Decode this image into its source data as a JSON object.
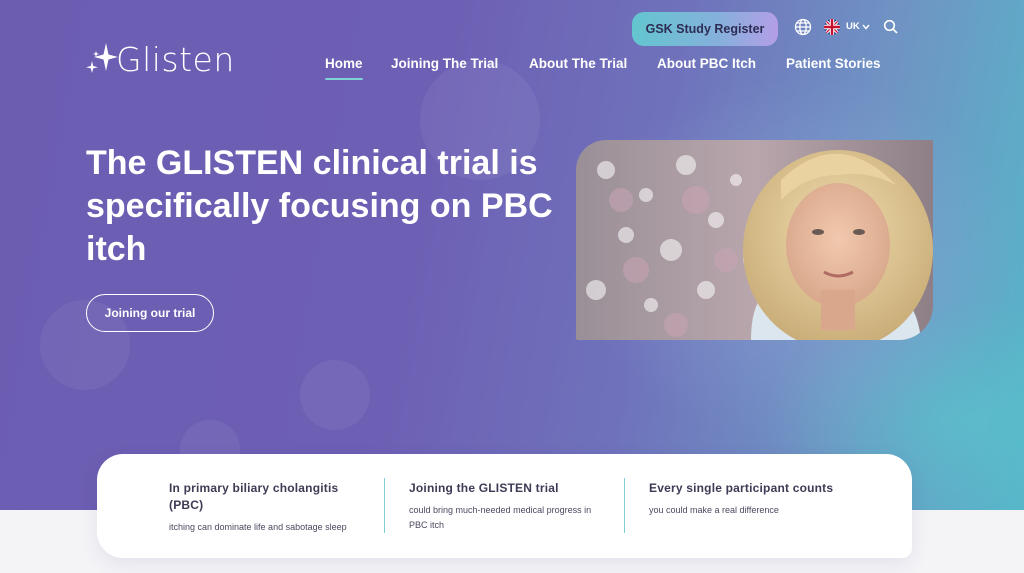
{
  "header": {
    "brand": "Glisten",
    "register_label": "GSK Study Register",
    "language": "UK"
  },
  "nav": {
    "items": [
      {
        "label": "Home",
        "active": true
      },
      {
        "label": "Joining The Trial"
      },
      {
        "label": "About The Trial"
      },
      {
        "label": "About PBC Itch"
      },
      {
        "label": "Patient Stories"
      }
    ]
  },
  "hero": {
    "headline": "The GLISTEN clinical trial is specifically focusing on PBC itch",
    "cta_label": "Joining our trial"
  },
  "features": [
    {
      "title": "In primary biliary cholangitis (PBC)",
      "text": "itching can dominate life and sabotage sleep"
    },
    {
      "title": "Joining the GLISTEN trial",
      "text": "could bring much-needed medical progress in PBC itch"
    },
    {
      "title": "Every single participant counts",
      "text": "you could make a real difference"
    }
  ],
  "colors": {
    "hero_purple": "#6c5db1",
    "accent_teal": "#63c6cf",
    "text_dark": "#3d3b55"
  },
  "icons": [
    "sparkle-logo-icon",
    "globe-icon",
    "uk-flag-icon",
    "chevron-down-icon",
    "search-icon"
  ]
}
